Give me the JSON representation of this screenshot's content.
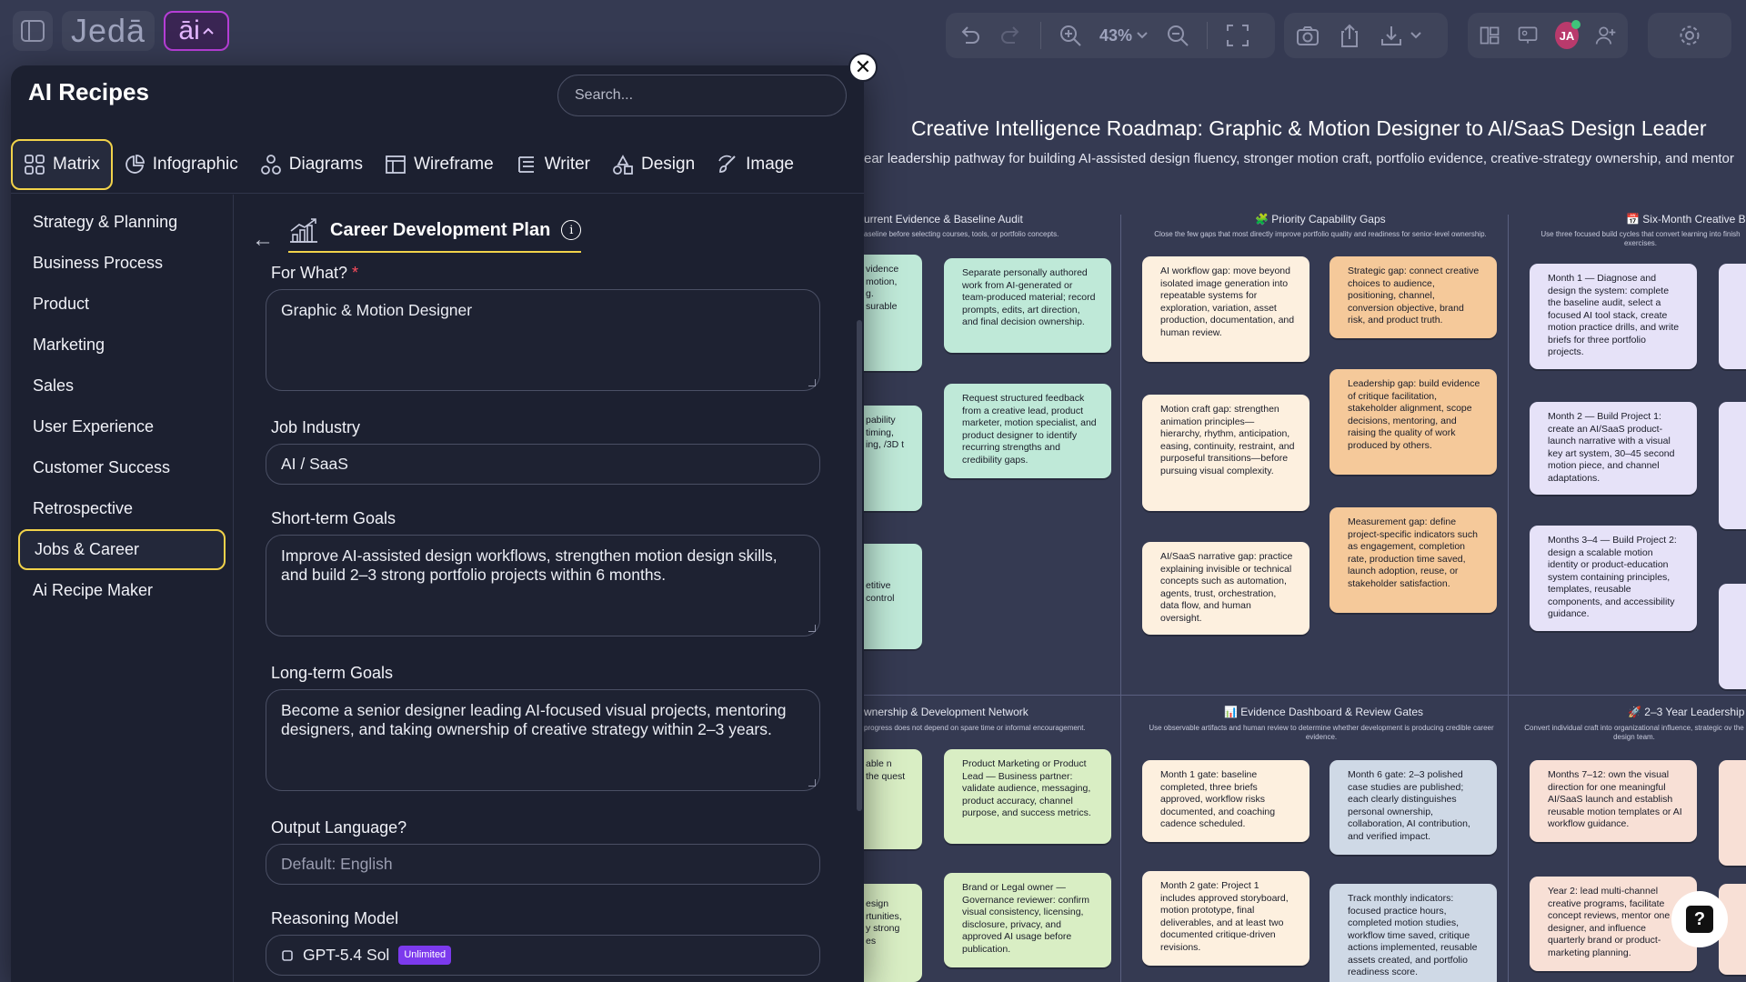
{
  "topbar": {
    "brand": "Jedā",
    "ai_button_label": "āi",
    "zoom": "43%",
    "avatar_initials": "JA"
  },
  "canvas": {
    "title": "Creative Intelligence Roadmap: Graphic & Motion Designer to AI/SaaS Design Leader",
    "subtitle": "ear leadership pathway for building AI-assisted design fluency, stronger motion craft, portfolio evidence, creative-strategy ownership, and mentor",
    "sections": [
      {
        "title": "urrent Evidence & Baseline Audit",
        "sub": "aseline before selecting courses, tools, or portfolio concepts."
      },
      {
        "title": "🧩 Priority Capability Gaps",
        "sub": "Close the few gaps that most directly improve portfolio quality and readiness for senior-level ownership."
      },
      {
        "title": "📅 Six-Month Creative Bu",
        "sub": "Use three focused build cycles that convert learning into finish exercises."
      },
      {
        "title": "wnership & Development Network",
        "sub": "progress does not depend on spare time or informal encouragement."
      },
      {
        "title": "📊 Evidence Dashboard & Review Gates",
        "sub": "Use observable artifacts and human review to determine whether development is producing credible career evidence."
      },
      {
        "title": "🚀 2–3 Year Leadership",
        "sub": "Convert individual craft into organizational influence, strategic ov the design team."
      }
    ],
    "cards": [
      {
        "text": "vidence motion, g. surable"
      },
      {
        "text": "Separate personally authored work from AI-generated or team-produced material; record prompts, edits, art direction, and final decision ownership."
      },
      {
        "text": "pability timing, ing, /3D t"
      },
      {
        "text": "Request structured feedback from a creative lead, product marketer, motion specialist, and product designer to identify recurring strengths and credibility gaps."
      },
      {
        "text": "etitive control"
      },
      {
        "text": "AI workflow gap: move beyond isolated image generation into repeatable systems for exploration, variation, asset production, documentation, and human review."
      },
      {
        "text": "Strategic gap: connect creative choices to audience, positioning, channel, conversion objective, brand risk, and product truth."
      },
      {
        "text": "Motion craft gap: strengthen animation principles—hierarchy, rhythm, anticipation, easing, continuity, restraint, and purposeful transitions—before pursuing visual complexity."
      },
      {
        "text": "Leadership gap: build evidence of critique facilitation, stakeholder alignment, scope decisions, mentoring, and raising the quality of work produced by others."
      },
      {
        "text": "AI/SaaS narrative gap: practice explaining invisible or technical concepts such as automation, agents, trust, orchestration, data flow, and human oversight."
      },
      {
        "text": "Measurement gap: define project-specific indicators such as engagement, completion rate, production time saved, launch adoption, reuse, or stakeholder satisfaction."
      },
      {
        "text": "Month 1 — Diagnose and design the system: complete the baseline audit, select a focused AI tool stack, create motion practice drills, and write briefs for three portfolio projects."
      },
      {
        "text": "Month 2 — Build Project 1: create an AI/SaaS product-launch narrative with a visual key art system, 30–45 second motion piece, and channel adaptations."
      },
      {
        "text": "Months 3–4 — Build Project 2: design a scalable motion identity or product-education system containing principles, templates, reusable components, and accessibility guidance."
      },
      {
        "text": "able n the quest"
      },
      {
        "text": "Product Marketing or Product Lead — Business partner: validate audience, messaging, product accuracy, channel purpose, and success metrics."
      },
      {
        "text": "esign rtunities, y strong es"
      },
      {
        "text": "Brand or Legal owner — Governance reviewer: confirm visual consistency, licensing, disclosure, privacy, and approved AI usage before publication."
      },
      {
        "text": "Month 1 gate: baseline completed, three briefs approved, workflow risks documented, and coaching cadence scheduled."
      },
      {
        "text": "Month 6 gate: 2–3 polished case studies are published; each clearly distinguishes personal ownership, collaboration, AI contribution, and verified impact."
      },
      {
        "text": "Month 2 gate: Project 1 includes approved storyboard, motion prototype, final deliverables, and at least two documented critique-driven revisions."
      },
      {
        "text": "Track monthly indicators: focused practice hours, completed motion studies, workflow time saved, critique actions implemented, reusable assets created, and portfolio readiness score."
      },
      {
        "text": "Months 7–12: own the visual direction for one meaningful AI/SaaS launch and establish reusable motion templates or AI workflow guidance."
      },
      {
        "text": "Year 2: lead multi-channel creative programs, facilitate concept reviews, mentor one designer, and influence quarterly brand or product-marketing planning."
      }
    ],
    "help_label": "?"
  },
  "panel": {
    "title": "AI Recipes",
    "search_placeholder": "Search...",
    "close_label": "✕",
    "tabs": [
      {
        "label": "Matrix",
        "icon": "grid-icon"
      },
      {
        "label": "Infographic",
        "icon": "pie-chart-icon"
      },
      {
        "label": "Diagrams",
        "icon": "shapes-icon"
      },
      {
        "label": "Wireframe",
        "icon": "wireframe-icon"
      },
      {
        "label": "Writer",
        "icon": "text-lines-icon"
      },
      {
        "label": "Design",
        "icon": "triangle-shapes-icon"
      },
      {
        "label": "Image",
        "icon": "brush-icon"
      }
    ],
    "categories": [
      "Strategy & Planning",
      "Business Process",
      "Product",
      "Marketing",
      "Sales",
      "User Experience",
      "Customer Success",
      "Retrospective",
      "Jobs & Career",
      "Ai Recipe Maker"
    ],
    "active_category": "Jobs & Career",
    "recipe": {
      "back": "←",
      "title": "Career Development Plan",
      "info": "i",
      "for_what_label": "For What?",
      "for_what_required": "*",
      "for_what_value": "Graphic & Motion Designer",
      "industry_label": "Job Industry",
      "industry_value": "AI / SaaS",
      "short_label": "Short-term Goals",
      "short_value": "Improve AI-assisted design workflows, strengthen motion design skills, and build 2–3 strong portfolio projects within 6 months.",
      "long_label": "Long-term Goals",
      "long_value": "Become a senior designer leading AI-focused visual projects, mentoring designers, and taking ownership of creative strategy within 2–3 years.",
      "language_label": "Output Language?",
      "language_placeholder": "Default: English",
      "reasoning_label": "Reasoning Model",
      "reasoning_value": "GPT-5.4 Sol",
      "reasoning_badge": "Unlimited"
    }
  },
  "colors": {
    "accent": "#f1d24a",
    "ai_brand": "#b63ed6",
    "required": "#ff4d5e"
  }
}
